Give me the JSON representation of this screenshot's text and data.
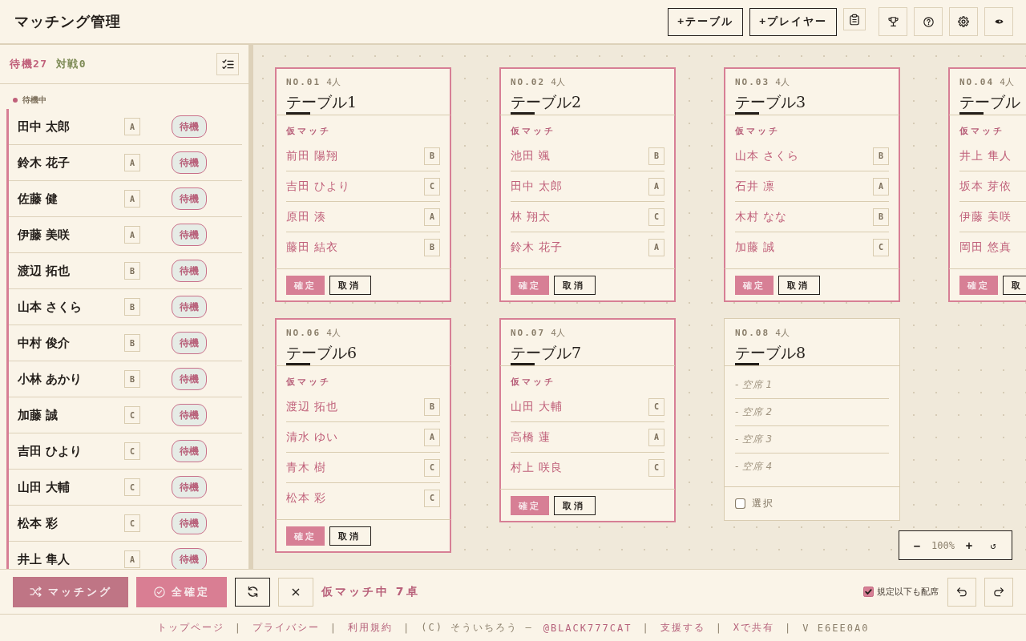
{
  "header": {
    "title": "マッチング管理",
    "buttons": [
      {
        "label": "+テーブル"
      },
      {
        "label": "+プレイヤー"
      }
    ]
  },
  "sidebar": {
    "counts": [
      {
        "label": "待機27",
        "kind": "waiting"
      },
      {
        "label": "対戦0",
        "kind": "playing"
      }
    ],
    "section": {
      "label": "待機中",
      "players": [
        {
          "name": "田中 太郎",
          "grade": "A",
          "status": "待機"
        },
        {
          "name": "鈴木 花子",
          "grade": "A",
          "status": "待機"
        },
        {
          "name": "佐藤 健",
          "grade": "A",
          "status": "待機"
        },
        {
          "name": "伊藤 美咲",
          "grade": "A",
          "status": "待機"
        },
        {
          "name": "渡辺 拓也",
          "grade": "B",
          "status": "待機"
        },
        {
          "name": "山本 さくら",
          "grade": "B",
          "status": "待機"
        },
        {
          "name": "中村 俊介",
          "grade": "B",
          "status": "待機"
        },
        {
          "name": "小林 あかり",
          "grade": "B",
          "status": "待機"
        },
        {
          "name": "加藤 誠",
          "grade": "C",
          "status": "待機"
        },
        {
          "name": "吉田 ひより",
          "grade": "C",
          "status": "待機"
        },
        {
          "name": "山田 大輔",
          "grade": "C",
          "status": "待機"
        },
        {
          "name": "松本 彩",
          "grade": "C",
          "status": "待機"
        },
        {
          "name": "井上 隼人",
          "grade": "A",
          "status": "待機"
        }
      ]
    }
  },
  "canvas": {
    "rows": [
      {
        "tables": [
          {
            "number": "NO.01",
            "capacity": "4人",
            "name": "テーブル1",
            "provisional": true,
            "match_label": "仮マッチ",
            "players": [
              {
                "name": "前田 陽翔",
                "grade": "B"
              },
              {
                "name": "吉田 ひより",
                "grade": "C"
              },
              {
                "name": "原田 湊",
                "grade": "A"
              },
              {
                "name": "藤田 結衣",
                "grade": "B"
              }
            ],
            "buttons": [
              {
                "label": "確定",
                "kind": "confirm"
              },
              {
                "label": "取消",
                "kind": "cancel"
              }
            ]
          },
          {
            "number": "NO.02",
            "capacity": "4人",
            "name": "テーブル2",
            "provisional": true,
            "match_label": "仮マッチ",
            "players": [
              {
                "name": "池田 颯",
                "grade": "B"
              },
              {
                "name": "田中 太郎",
                "grade": "A"
              },
              {
                "name": "林 翔太",
                "grade": "C"
              },
              {
                "name": "鈴木 花子",
                "grade": "A"
              }
            ],
            "buttons": [
              {
                "label": "確定",
                "kind": "confirm"
              },
              {
                "label": "取消",
                "kind": "cancel"
              }
            ]
          },
          {
            "number": "NO.03",
            "capacity": "4人",
            "name": "テーブル3",
            "provisional": true,
            "match_label": "仮マッチ",
            "players": [
              {
                "name": "山本 さくら",
                "grade": "B"
              },
              {
                "name": "石井 凛",
                "grade": "A"
              },
              {
                "name": "木村 なな",
                "grade": "B"
              },
              {
                "name": "加藤 誠",
                "grade": "C"
              }
            ],
            "buttons": [
              {
                "label": "確定",
                "kind": "confirm"
              },
              {
                "label": "取消",
                "kind": "cancel"
              }
            ]
          },
          {
            "number": "NO.04",
            "capacity": "4人",
            "name": "テーブル",
            "provisional": true,
            "match_label": "仮マッチ",
            "players": [
              {
                "name": "井上 隼人"
              },
              {
                "name": "坂本 芽依"
              },
              {
                "name": "伊藤 美咲"
              },
              {
                "name": "岡田 悠真"
              }
            ],
            "buttons": [
              {
                "label": "確定",
                "kind": "confirm"
              },
              {
                "label": "取",
                "kind": "cancel"
              }
            ]
          }
        ]
      },
      {
        "tables": [
          {
            "number": "NO.06",
            "capacity": "4人",
            "name": "テーブル6",
            "provisional": true,
            "match_label": "仮マッチ",
            "players": [
              {
                "name": "渡辺 拓也",
                "grade": "B"
              },
              {
                "name": "清水 ゆい",
                "grade": "A"
              },
              {
                "name": "青木 樹",
                "grade": "C"
              },
              {
                "name": "松本 彩",
                "grade": "C"
              }
            ],
            "buttons": [
              {
                "label": "確定",
                "kind": "confirm"
              },
              {
                "label": "取消",
                "kind": "cancel"
              }
            ]
          },
          {
            "number": "NO.07",
            "capacity": "4人",
            "name": "テーブル7",
            "provisional": true,
            "match_label": "仮マッチ",
            "players": [
              {
                "name": "山田 大輔",
                "grade": "C"
              },
              {
                "name": "高橋 蓮",
                "grade": "A"
              },
              {
                "name": "村上 咲良",
                "grade": "C"
              }
            ],
            "buttons": [
              {
                "label": "確定",
                "kind": "confirm"
              },
              {
                "label": "取消",
                "kind": "cancel"
              }
            ]
          },
          {
            "number": "NO.08",
            "capacity": "4人",
            "name": "テーブル8",
            "provisional": false,
            "seats": [
              "- 空席 1",
              "- 空席 2",
              "- 空席 3",
              "- 空席 4"
            ],
            "select": {
              "label": "選択",
              "checked": false
            }
          }
        ]
      }
    ],
    "zoom": {
      "minus": "−",
      "percent": "100%",
      "plus": "+",
      "reset": "↺"
    }
  },
  "bottom_bar": {
    "actions": [
      {
        "label": "マッチング",
        "kind": "match"
      },
      {
        "label": "全確定",
        "kind": "confirm_all"
      }
    ],
    "clear": "×",
    "status": "仮マッチ中 7卓",
    "option": {
      "label": "規定以下も配席",
      "checked": true
    }
  },
  "footer": {
    "items": [
      {
        "kind": "link",
        "text": "トップページ"
      },
      {
        "kind": "sep",
        "text": "|"
      },
      {
        "kind": "link",
        "text": "プライバシー"
      },
      {
        "kind": "sep",
        "text": "|"
      },
      {
        "kind": "link",
        "text": "利用規約"
      },
      {
        "kind": "sep",
        "text": "|"
      },
      {
        "kind": "text",
        "text": "(C) そういちろう —"
      },
      {
        "kind": "link",
        "text": "@BLACK777CAT"
      },
      {
        "kind": "sep",
        "text": "|"
      },
      {
        "kind": "link",
        "text": "支援する"
      },
      {
        "kind": "sep",
        "text": "|"
      },
      {
        "kind": "link",
        "text": "Xで共有"
      },
      {
        "kind": "sep",
        "text": "|"
      },
      {
        "kind": "text",
        "text": "V E6EE0A0"
      }
    ]
  }
}
